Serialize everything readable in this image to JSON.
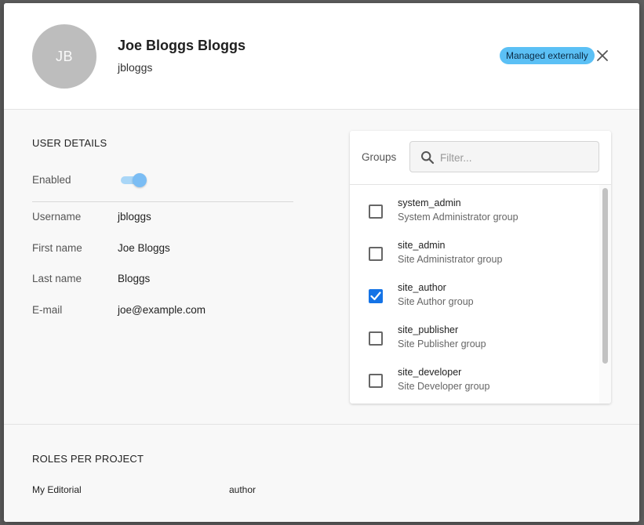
{
  "user": {
    "initials": "JB",
    "full_name": "Joe Bloggs Bloggs",
    "username": "jbloggs",
    "badge": "Managed externally"
  },
  "details": {
    "title": "USER DETAILS",
    "enabled_label": "Enabled",
    "enabled": true,
    "fields": [
      {
        "label": "Username",
        "value": "jbloggs"
      },
      {
        "label": "First name",
        "value": "Joe Bloggs"
      },
      {
        "label": "Last name",
        "value": "Bloggs"
      },
      {
        "label": "E-mail",
        "value": "joe@example.com"
      }
    ]
  },
  "groups": {
    "label": "Groups",
    "filter_placeholder": "Filter...",
    "items": [
      {
        "name": "system_admin",
        "description": "System Administrator group",
        "checked": false
      },
      {
        "name": "site_admin",
        "description": "Site Administrator group",
        "checked": false
      },
      {
        "name": "site_author",
        "description": "Site Author group",
        "checked": true
      },
      {
        "name": "site_publisher",
        "description": "Site Publisher group",
        "checked": false
      },
      {
        "name": "site_developer",
        "description": "Site Developer group",
        "checked": false
      }
    ]
  },
  "roles": {
    "title": "ROLES PER PROJECT",
    "rows": [
      {
        "project": "My Editorial",
        "role": "author"
      }
    ]
  },
  "icons": {
    "close": "close-icon",
    "search": "search-icon",
    "check": "checkmark-icon"
  },
  "colors": {
    "badge_bg": "#5bc0f5",
    "checkbox_checked": "#1473e6",
    "toggle_on": "#7bbdf4"
  }
}
